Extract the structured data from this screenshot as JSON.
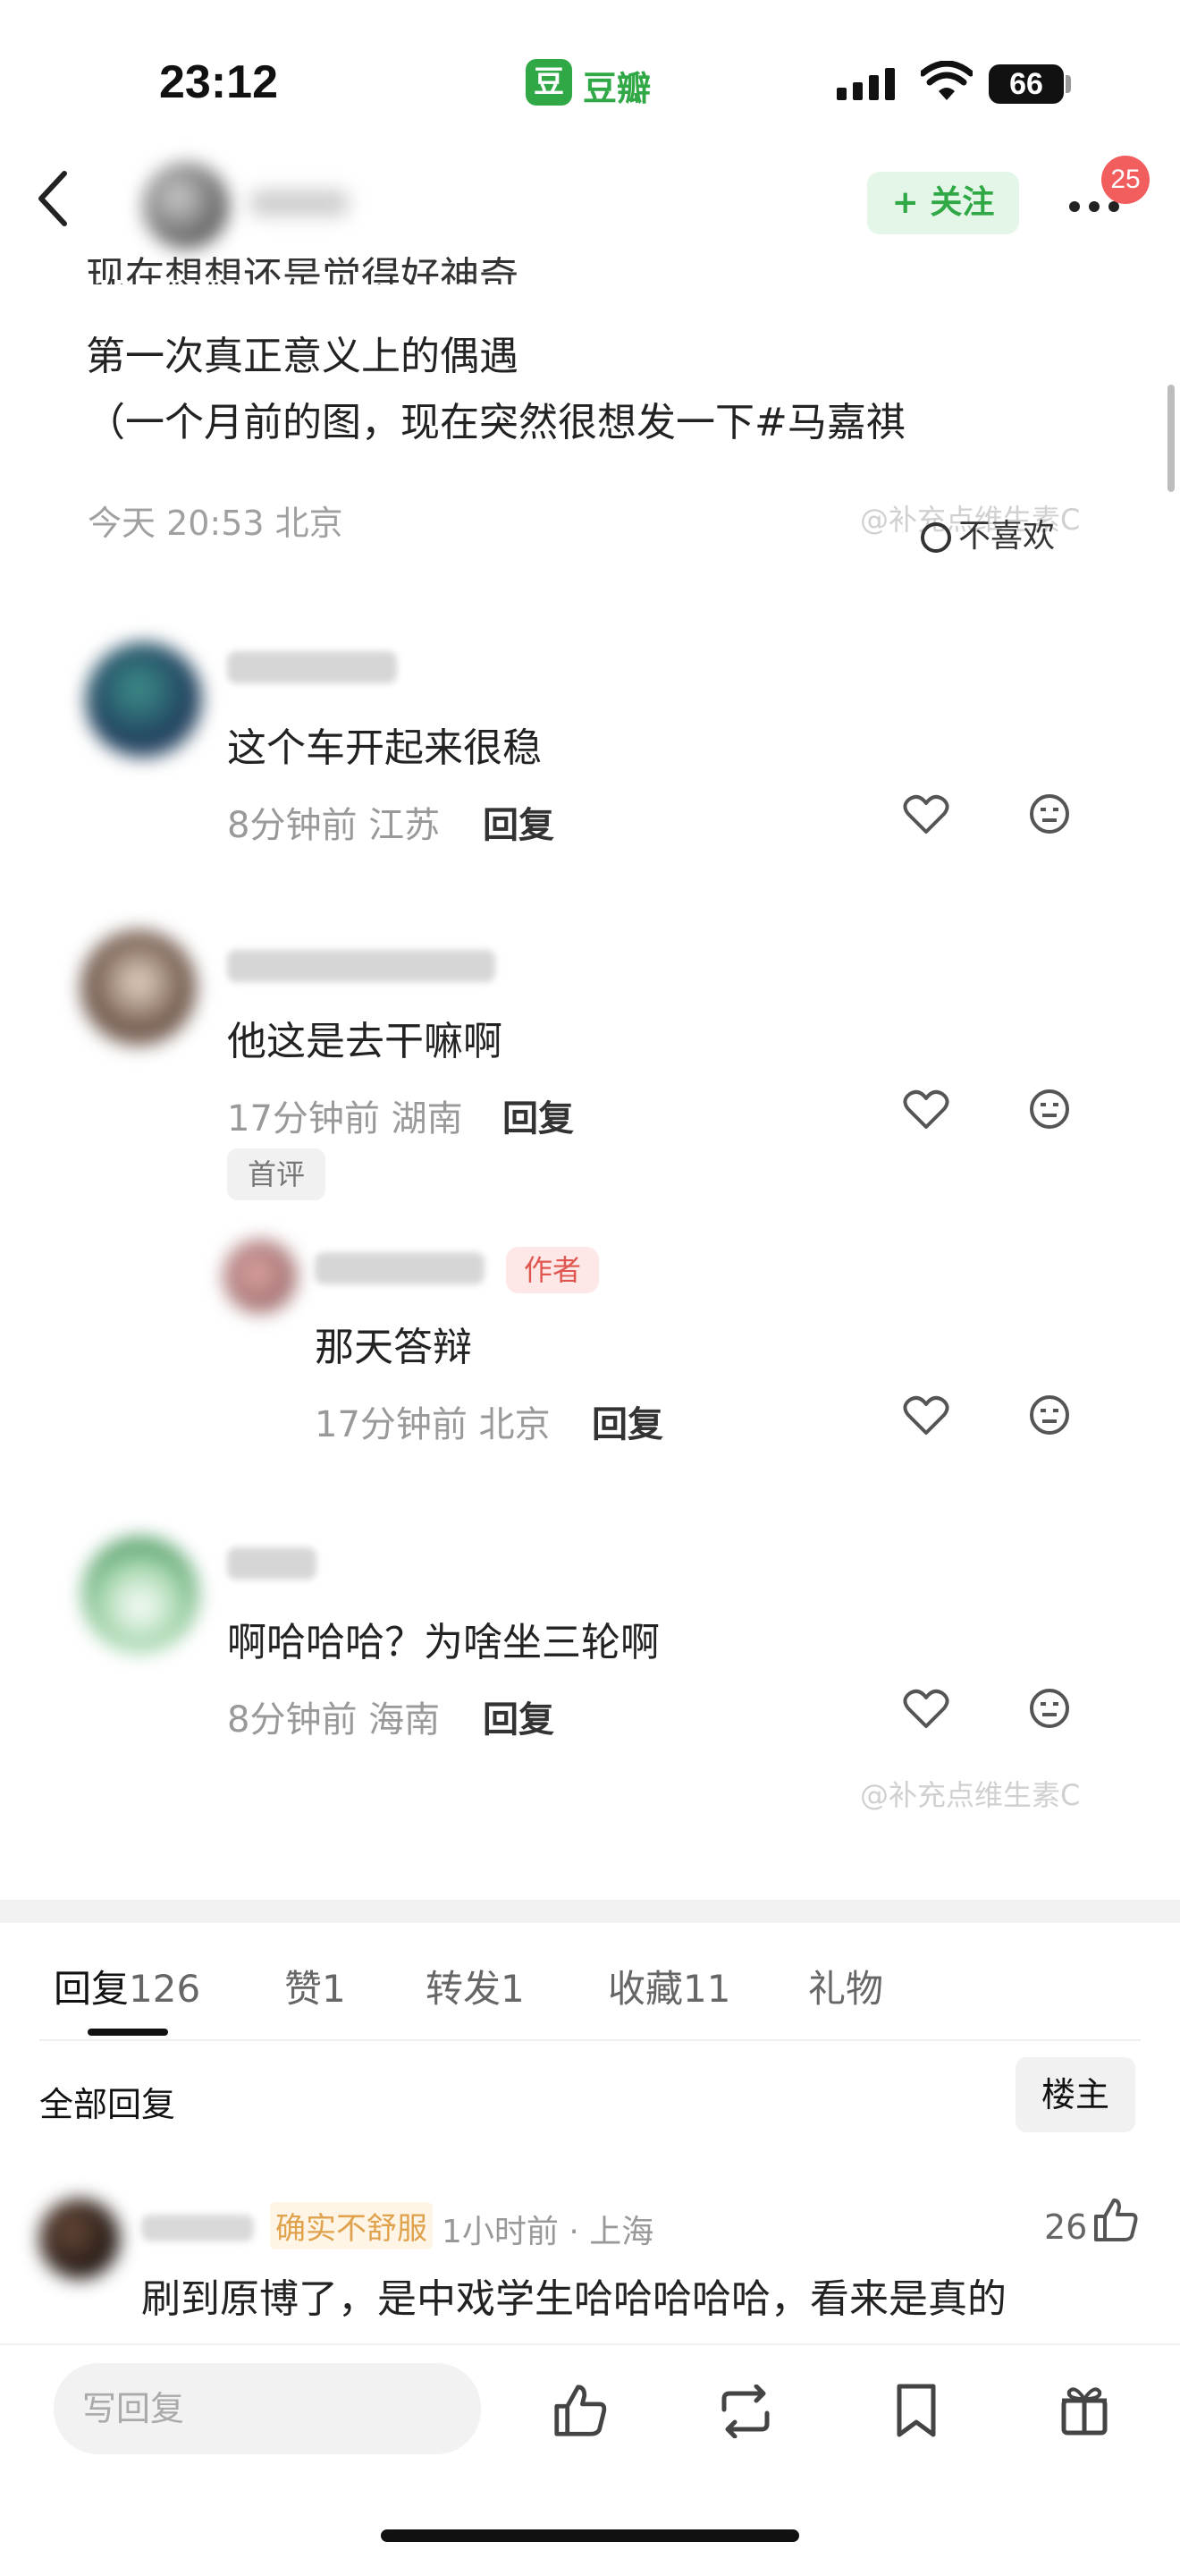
{
  "status_bar": {
    "time": "23:12",
    "app_badge": "豆",
    "app_name": "豆瓣",
    "battery": "66"
  },
  "nav": {
    "follow_label": "+ 关注",
    "notification_count": "25"
  },
  "post": {
    "partial_line": "现在想想还是觉得好神奇",
    "lines": [
      "第一次真正意义上的偶遇",
      "（一个月前的图，现在突然很想发一下#马嘉祺"
    ],
    "time_location": "今天 20:53 北京",
    "dislike_label": "不喜欢",
    "watermark": "@补充点维生素C"
  },
  "comments": [
    {
      "text": "这个车开起来很稳",
      "meta": "8分钟前 江苏",
      "reply_label": "回复"
    },
    {
      "text": "他这是去干嘛啊",
      "meta": "17分钟前 湖南",
      "reply_label": "回复",
      "tag": "首评"
    },
    {
      "author_tag": "作者",
      "text": "那天答辩",
      "meta": "17分钟前 北京",
      "reply_label": "回复"
    },
    {
      "text": "啊哈哈哈？为啥坐三轮啊",
      "meta": "8分钟前 海南",
      "reply_label": "回复"
    }
  ],
  "tabs": [
    {
      "label": "回复",
      "count": "126"
    },
    {
      "label": "赞",
      "count": "1"
    },
    {
      "label": "转发",
      "count": "1"
    },
    {
      "label": "收藏",
      "count": "11"
    },
    {
      "label": "礼物",
      "count": ""
    }
  ],
  "replies_section": {
    "all_label": "全部回复",
    "owner_label": "楼主"
  },
  "top_reply": {
    "tag": "确实不舒服",
    "meta": "1小时前 · 上海",
    "likes": "26",
    "text": "刷到原博了，是中戏学生哈哈哈哈哈，看来是真的"
  },
  "bottom_bar": {
    "input_placeholder": "写回复"
  },
  "colors": {
    "accent": "#2fa845",
    "badge": "#f25d5d",
    "author_tag": "#e0554d"
  }
}
